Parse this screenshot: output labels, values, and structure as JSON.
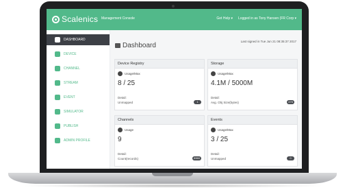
{
  "app": {
    "logo_text": "Scalenics",
    "nav_console": "Management Console",
    "top_right": [
      "Get Help ▾",
      "Logged in as Tony Hansen (FR Corp ▾"
    ]
  },
  "sidebar": {
    "items": [
      {
        "label": "DASHBOARD",
        "active": true,
        "icon": "dashboard-icon"
      },
      {
        "label": "DEVICE",
        "active": false,
        "icon": "key-icon"
      },
      {
        "label": "CHANNEL",
        "active": false,
        "icon": "file-icon"
      },
      {
        "label": "STREAM",
        "active": false,
        "icon": "chart-icon"
      },
      {
        "label": "EVENT",
        "active": false,
        "icon": "gear-icon"
      },
      {
        "label": "SIMULATOR",
        "active": false,
        "icon": "simulator-icon"
      },
      {
        "label": "PUBLISH",
        "active": false,
        "icon": "publish-icon"
      },
      {
        "label": "ADMIN PROFILE",
        "active": false,
        "icon": "user-icon"
      }
    ]
  },
  "main": {
    "title": "Dashboard",
    "signed_in": "Last signed in Tue Jun 21 08:35:37 2017"
  },
  "cards": [
    {
      "title": "Device Registry",
      "sub": "Usage/Max",
      "value": "8 / 25",
      "detail_label": "Detail:",
      "detail": "Unmapped",
      "badge": "1",
      "icon": "key-icon"
    },
    {
      "title": "Storage",
      "sub": "Usage/Max",
      "value": "4.1M / 5000M",
      "detail_label": "Detail:",
      "detail": "Avg. Obj Size(bytes)",
      "badge": "475",
      "icon": "pie-icon"
    },
    {
      "title": "Channels",
      "sub": "Usage",
      "value": "9",
      "detail_label": "Detail:",
      "detail": "Count(records)",
      "badge": "8960",
      "icon": "database-icon"
    },
    {
      "title": "Events",
      "sub": "Usage/Max",
      "value": "3 / 25",
      "detail_label": "Detail:",
      "detail": "Unmapped",
      "badge": "0",
      "icon": "gear-icon"
    }
  ],
  "colors": {
    "accent": "#52b98a",
    "sidebar_active": "#3d4046"
  }
}
